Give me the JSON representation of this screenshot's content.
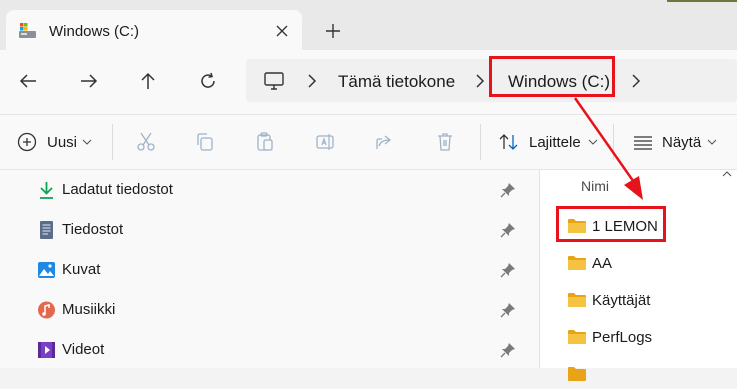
{
  "tab": {
    "title": "Windows (C:)"
  },
  "address": {
    "crumbs": [
      "Tämä tietokone",
      "Windows (C:)"
    ]
  },
  "toolbar": {
    "new_label": "Uusi",
    "sort_label": "Lajittele",
    "view_label": "Näytä"
  },
  "nav_pane": {
    "items": [
      {
        "label": "Ladatut tiedostot",
        "icon": "download-icon"
      },
      {
        "label": "Tiedostot",
        "icon": "documents-icon"
      },
      {
        "label": "Kuvat",
        "icon": "pictures-icon"
      },
      {
        "label": "Musiikki",
        "icon": "music-icon"
      },
      {
        "label": "Videot",
        "icon": "videos-icon"
      }
    ]
  },
  "file_list": {
    "column_header": "Nimi",
    "items": [
      "1 LEMON",
      "AA",
      "Käyttäjät",
      "PerfLogs"
    ]
  },
  "colors": {
    "annotation": "#e8121a",
    "folder": "#f5c242",
    "accent": "#0067c0"
  }
}
